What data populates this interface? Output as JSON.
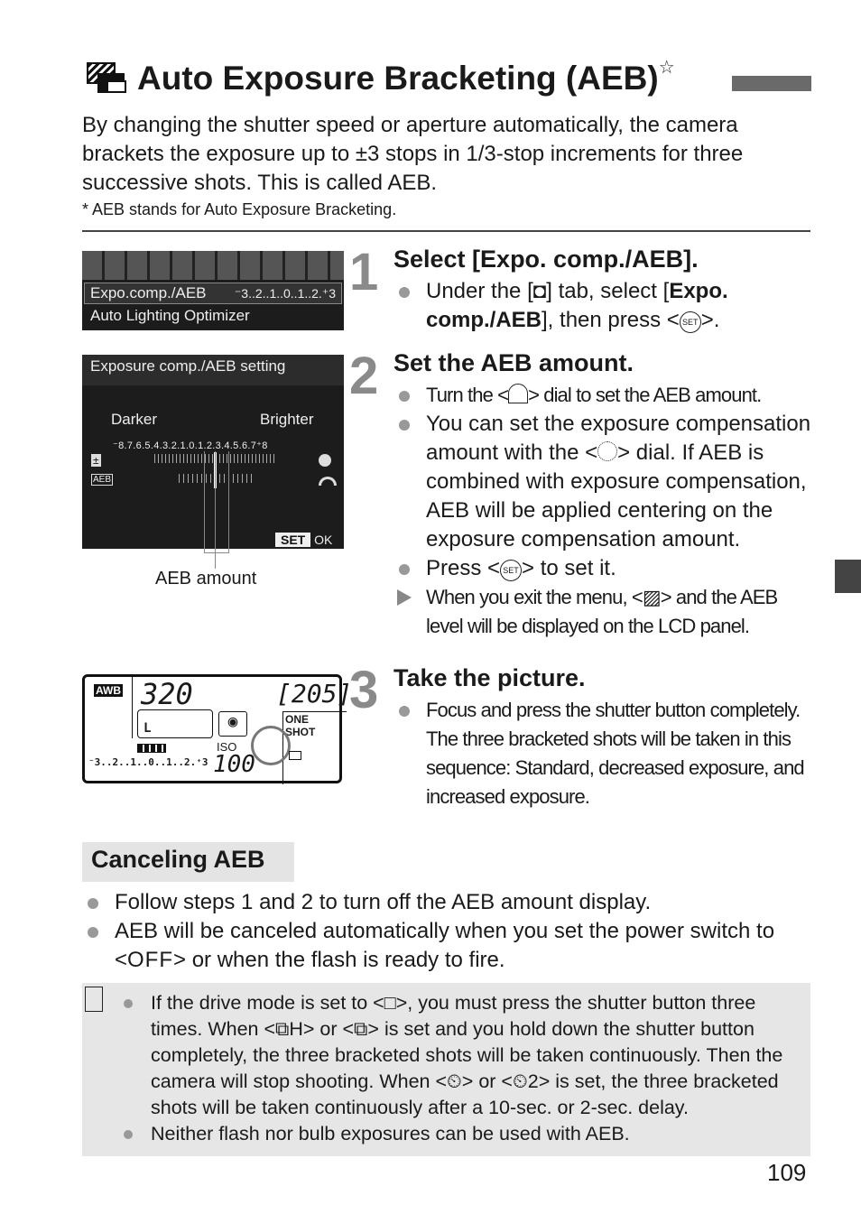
{
  "title": {
    "text": "Auto Exposure Bracketing (AEB)",
    "star": "☆"
  },
  "intro": "By changing the shutter speed or aperture automatically, the camera brackets the exposure up to ±3 stops in 1/3-stop increments for three successive shots. This is called AEB.",
  "footnote": "* AEB stands for Auto Exposure Bracketing.",
  "screen1": {
    "row1_label": "Expo.comp./AEB",
    "row1_value": "⁻3..2..1..0..1..2.⁺3",
    "row2_label": "Auto Lighting Optimizer"
  },
  "screen2": {
    "title": "Exposure comp./AEB setting",
    "darker": "Darker",
    "brighter": "Brighter",
    "scale": "⁻8.7.6.5.4.3.2.1.0.1.2.3.4.5.6.7⁺8",
    "set": "SET",
    "ok": "OK",
    "caption": "AEB amount"
  },
  "lcd": {
    "awb": "AWB",
    "shutter": "320",
    "shots": "[205]",
    "one_shot": "ONE SHOT",
    "iso_label": "ISO",
    "iso": "100",
    "scale": "⁻3..2..1..0..1..2.⁺3",
    "quality": "L"
  },
  "steps": [
    {
      "num": "1",
      "heading": "Select [Expo. comp./AEB].",
      "b1a": "Under the [",
      "b1b": "] tab, select [",
      "b1c": "Expo. comp./AEB",
      "b1d": "], then press <",
      "b1e": ">."
    },
    {
      "num": "2",
      "heading": "Set the AEB amount.",
      "b1a": "Turn the <",
      "b1b": "> dial to set the AEB amount.",
      "b2a": "You can set the exposure compensation amount with the <",
      "b2b": "> dial. If AEB is combined with exposure compensation, AEB will be applied centering on the exposure compensation amount.",
      "b3a": "Press <",
      "b3b": "> to set it.",
      "b4a": "When you exit the menu, <",
      "b4b": "> and the AEB level will be displayed on the LCD panel."
    },
    {
      "num": "3",
      "heading": "Take the picture.",
      "b1": "Focus and press the shutter button completely. The three bracketed shots will be taken in this sequence: Standard, decreased exposure, and increased exposure."
    }
  ],
  "set_icon": "SET",
  "canceling": {
    "heading": "Canceling AEB",
    "b1": "Follow steps 1 and 2 to turn off the AEB amount display.",
    "b2a": "AEB will be canceled automatically when you set the power switch to <",
    "b2off": "OFF",
    "b2b": "> or when the flash is ready to fire."
  },
  "note": {
    "icon": "note-icon",
    "b1": "If the drive mode is set to <□>, you must press the shutter button three times. When <⧉H> or <⧉> is set and you hold down the shutter button completely, the three bracketed shots will be taken continuously. Then the camera will stop shooting. When <⏲> or <⏲2> is set, the three bracketed shots will be taken continuously after a 10-sec. or 2-sec. delay.",
    "b2": "Neither flash nor bulb exposures can be used with AEB."
  },
  "page_number": "109"
}
